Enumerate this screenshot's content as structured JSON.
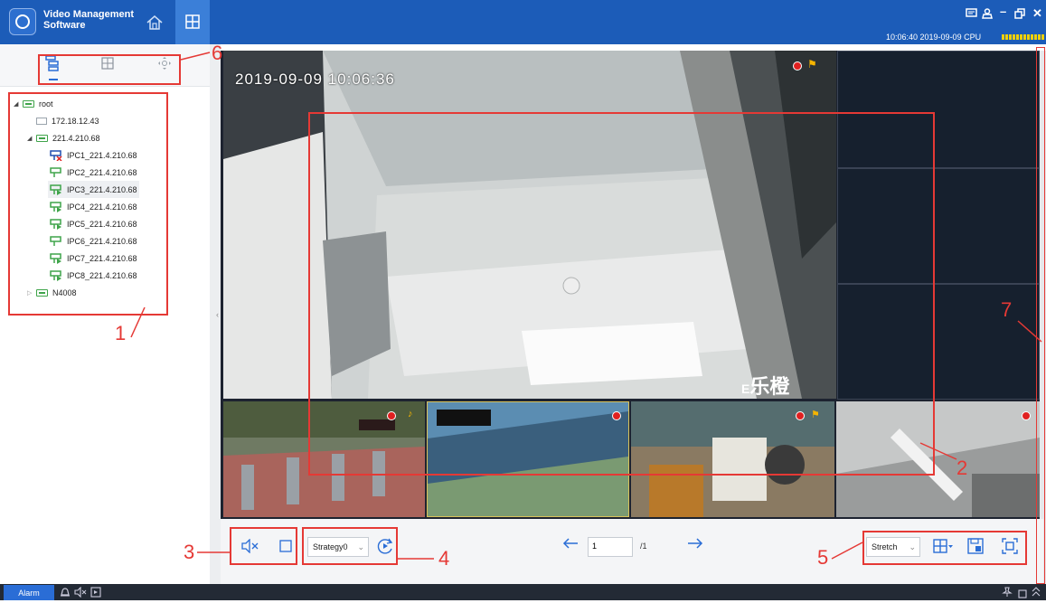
{
  "app": {
    "title_line1": "Video Management",
    "title_line2": "Software"
  },
  "window_controls": {
    "chat_icon": "▣",
    "user_icon": "Δ",
    "minimize": "–",
    "restore": "ɒ",
    "close": "✕"
  },
  "status": {
    "datetime_cpu": "10:06:40 2019-09-09 CPU"
  },
  "tree": {
    "root": "root",
    "nodes": [
      {
        "label": "172.18.12.43",
        "kind": "dev"
      },
      {
        "label": "221.4.210.68",
        "kind": "folder"
      },
      {
        "label": "IPC1_221.4.210.68",
        "kind": "cam",
        "color": "#1f4db0"
      },
      {
        "label": "IPC2_221.4.210.68",
        "kind": "cam",
        "color": "#3fa44a"
      },
      {
        "label": "IPC3_221.4.210.68",
        "kind": "cam",
        "color": "#3fa44a"
      },
      {
        "label": "IPC4_221.4.210.68",
        "kind": "cam",
        "color": "#3fa44a"
      },
      {
        "label": "IPC5_221.4.210.68",
        "kind": "cam",
        "color": "#3fa44a"
      },
      {
        "label": "IPC6_221.4.210.68",
        "kind": "cam",
        "color": "#3fa44a"
      },
      {
        "label": "IPC7_221.4.210.68",
        "kind": "cam",
        "color": "#3fa44a"
      },
      {
        "label": "IPC8_221.4.210.68",
        "kind": "cam",
        "color": "#3fa44a"
      },
      {
        "label": "N4008",
        "kind": "folder"
      }
    ]
  },
  "video": {
    "main_timestamp": "2019-09-09 10:06:36",
    "watermark": "乐橙"
  },
  "toolbar": {
    "strategy": "Strategy0",
    "page_current": "1",
    "page_total": "/1",
    "stretch": "Stretch"
  },
  "annotations": [
    "1",
    "2",
    "3",
    "4",
    "5",
    "6",
    "7"
  ],
  "statusbar": {
    "alarm": "Alarm"
  },
  "colors": {
    "titlebar": "#1c5cb8",
    "accent": "#2a6dd6",
    "annotation": "#e53935"
  }
}
